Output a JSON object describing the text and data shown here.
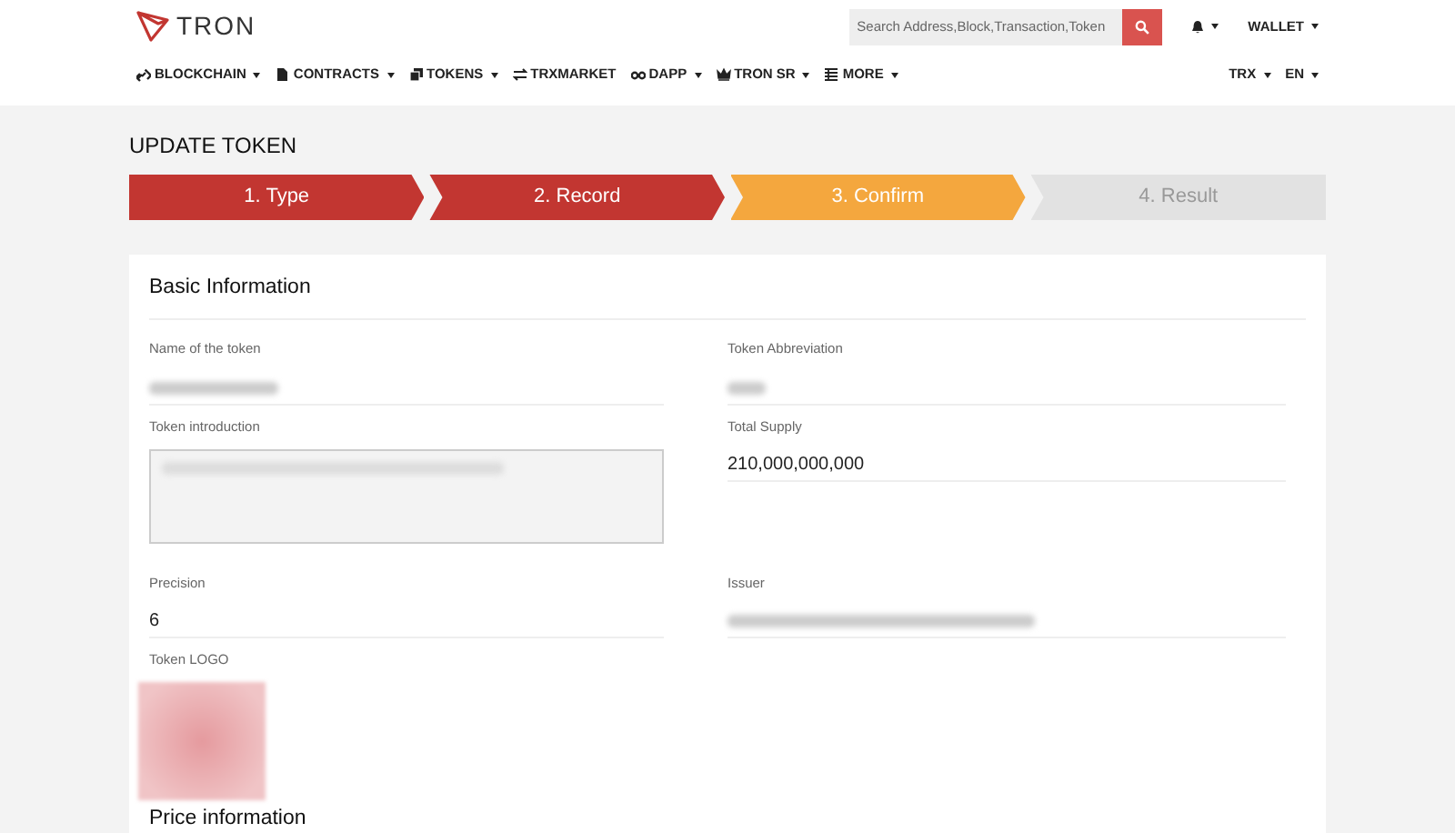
{
  "header": {
    "logo_text": "TRON",
    "search": {
      "placeholder": "Search Address,Block,Transaction,Token"
    },
    "wallet": "WALLET"
  },
  "nav": [
    {
      "label": "BLOCKCHAIN",
      "dropdown": true
    },
    {
      "label": "CONTRACTS",
      "dropdown": true
    },
    {
      "label": "TOKENS",
      "dropdown": true
    },
    {
      "label": "TRXMARKET",
      "dropdown": false
    },
    {
      "label": "DAPP",
      "dropdown": true
    },
    {
      "label": "TRON SR",
      "dropdown": true
    },
    {
      "label": "MORE",
      "dropdown": true
    }
  ],
  "nav_right": [
    {
      "label": "TRX"
    },
    {
      "label": "EN"
    }
  ],
  "page_title": "UPDATE TOKEN",
  "steps": [
    {
      "label": "1. Type",
      "kind": "done"
    },
    {
      "label": "2. Record",
      "kind": "done"
    },
    {
      "label": "3. Confirm",
      "kind": "current"
    },
    {
      "label": "4. Result",
      "kind": "pending"
    }
  ],
  "section_title": "Basic Information",
  "fields": [
    {
      "label": "Name of the token",
      "kind": "blurred"
    },
    {
      "label": "Token Abbreviation",
      "kind": "blurred"
    },
    {
      "label": "Token introduction",
      "kind": "textarea"
    },
    {
      "label": "Total Supply",
      "kind": "text",
      "value": "210,000,000,000"
    },
    {
      "label": "Precision",
      "kind": "text",
      "value": "6"
    },
    {
      "label": "Issuer",
      "kind": "blurred"
    },
    {
      "label": "Token LOGO",
      "kind": "image"
    }
  ],
  "next_section_title": "Price information"
}
